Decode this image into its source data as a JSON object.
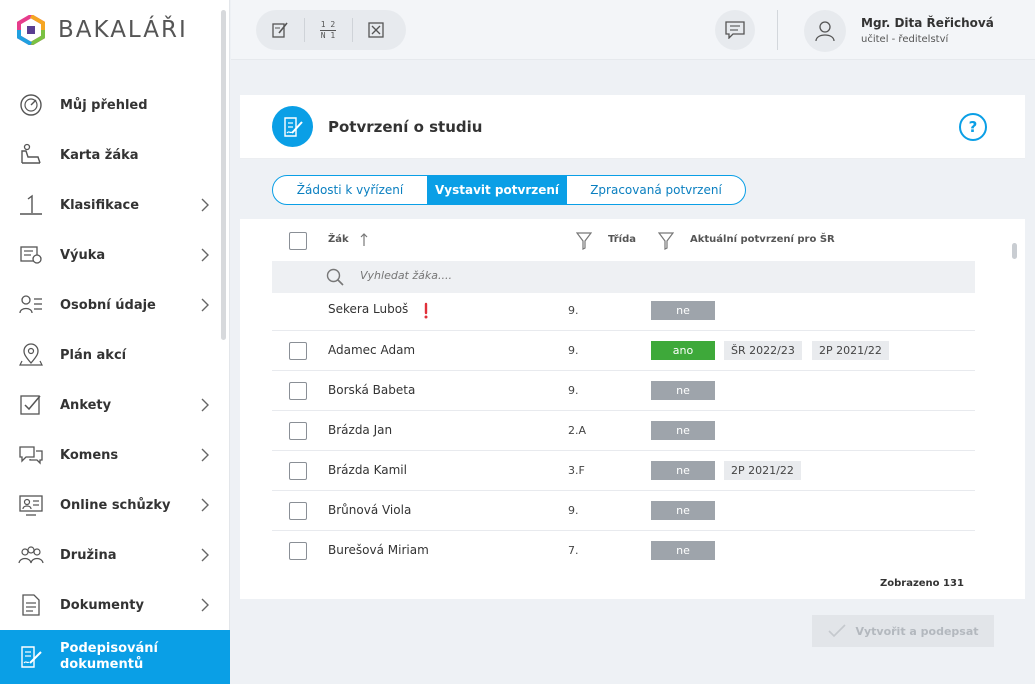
{
  "app": {
    "logo_text": "BAKALÁŘI"
  },
  "sidebar": {
    "items": [
      {
        "label": "Můj přehled",
        "icon": "dashboard-icon",
        "has_children": false
      },
      {
        "label": "Karta žáka",
        "icon": "student-icon",
        "has_children": false
      },
      {
        "label": "Klasifikace",
        "icon": "grade-icon",
        "has_children": true
      },
      {
        "label": "Výuka",
        "icon": "teaching-icon",
        "has_children": true
      },
      {
        "label": "Osobní údaje",
        "icon": "personal-data-icon",
        "has_children": true
      },
      {
        "label": "Plán akcí",
        "icon": "map-pin-icon",
        "has_children": false
      },
      {
        "label": "Ankety",
        "icon": "poll-icon",
        "has_children": true
      },
      {
        "label": "Komens",
        "icon": "chat-icon",
        "has_children": true
      },
      {
        "label": "Online schůzky",
        "icon": "video-meeting-icon",
        "has_children": true
      },
      {
        "label": "Družina",
        "icon": "group-icon",
        "has_children": true
      },
      {
        "label": "Dokumenty",
        "icon": "document-icon",
        "has_children": true
      }
    ],
    "active": {
      "label_line1": "Podepisování",
      "label_line2": "dokumentů",
      "icon": "sign-document-icon"
    }
  },
  "topbar": {
    "user_name": "Mgr. Dita Řeřichová",
    "user_role": "učitel - ředitelství",
    "frac_top": "1 2",
    "frac_bottom": "N 1"
  },
  "page": {
    "title": "Potvrzení o studiu",
    "help": "?",
    "tabs": [
      "Žádosti k vyřízení",
      "Vystavit potvrzení",
      "Zpracovaná potvrzení"
    ],
    "active_tab": 1
  },
  "table": {
    "headers": {
      "student": "Žák",
      "class": "Třída",
      "current": "Aktuální potvrzení pro ŠR"
    },
    "search_placeholder": "Vyhledat žáka....",
    "rows": [
      {
        "name": "Sekera Luboš",
        "class": "9.",
        "status": "ne",
        "tags": [],
        "warning": true,
        "checkbox": false
      },
      {
        "name": "Adamec Adam",
        "class": "9.",
        "status": "ano",
        "tags": [
          "ŠR 2022/23",
          "2P 2021/22"
        ],
        "warning": false,
        "checkbox": true
      },
      {
        "name": "Borská Babeta",
        "class": "9.",
        "status": "ne",
        "tags": [],
        "warning": false,
        "checkbox": true
      },
      {
        "name": "Brázda Jan",
        "class": "2.A",
        "status": "ne",
        "tags": [],
        "warning": false,
        "checkbox": true
      },
      {
        "name": "Brázda Kamil",
        "class": "3.F",
        "status": "ne",
        "tags": [
          "2P 2021/22"
        ],
        "warning": false,
        "checkbox": true
      },
      {
        "name": "Brůnová Viola",
        "class": "9.",
        "status": "ne",
        "tags": [],
        "warning": false,
        "checkbox": true
      },
      {
        "name": "Burešová Miriam",
        "class": "7.",
        "status": "ne",
        "tags": [],
        "warning": false,
        "checkbox": true
      }
    ],
    "shown_text": "Zobrazeno 131"
  },
  "actions": {
    "create_label": "Vytvořit a podepsat"
  },
  "colors": {
    "accent": "#0a9fe6",
    "yes": "#3ea93a",
    "no": "#9ea4ab"
  }
}
